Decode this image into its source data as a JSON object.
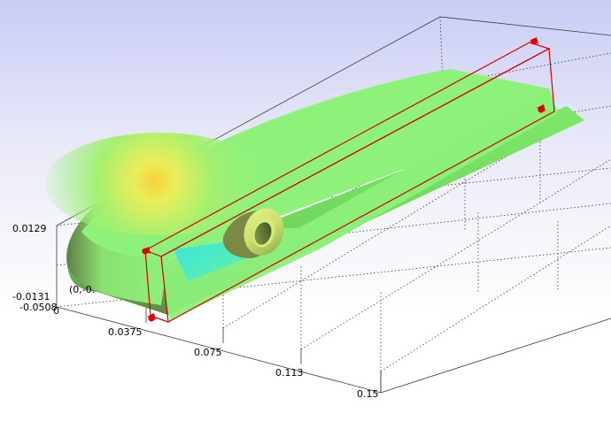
{
  "viewer": {
    "axis_ticks": {
      "z_top": "0.0129",
      "z_bottom": "-0.0131",
      "y_min": "-0.0508",
      "origin_zero": "0",
      "origin_partial": "(0,-0.",
      "x1": "0.0375",
      "x2": "0.075",
      "x3": "0.113",
      "x4": "0.15"
    },
    "colors": {
      "background_top": "#c9cdf4",
      "background_bottom": "#ffffff",
      "surface_main": "#8ef27a",
      "surface_hot": "#f5e34a",
      "surface_cold": "#40e8d8",
      "selection_box": "#d40000",
      "handle": "#e00000"
    },
    "icons": {
      "handle": "red-dragger-handle-icon"
    }
  }
}
